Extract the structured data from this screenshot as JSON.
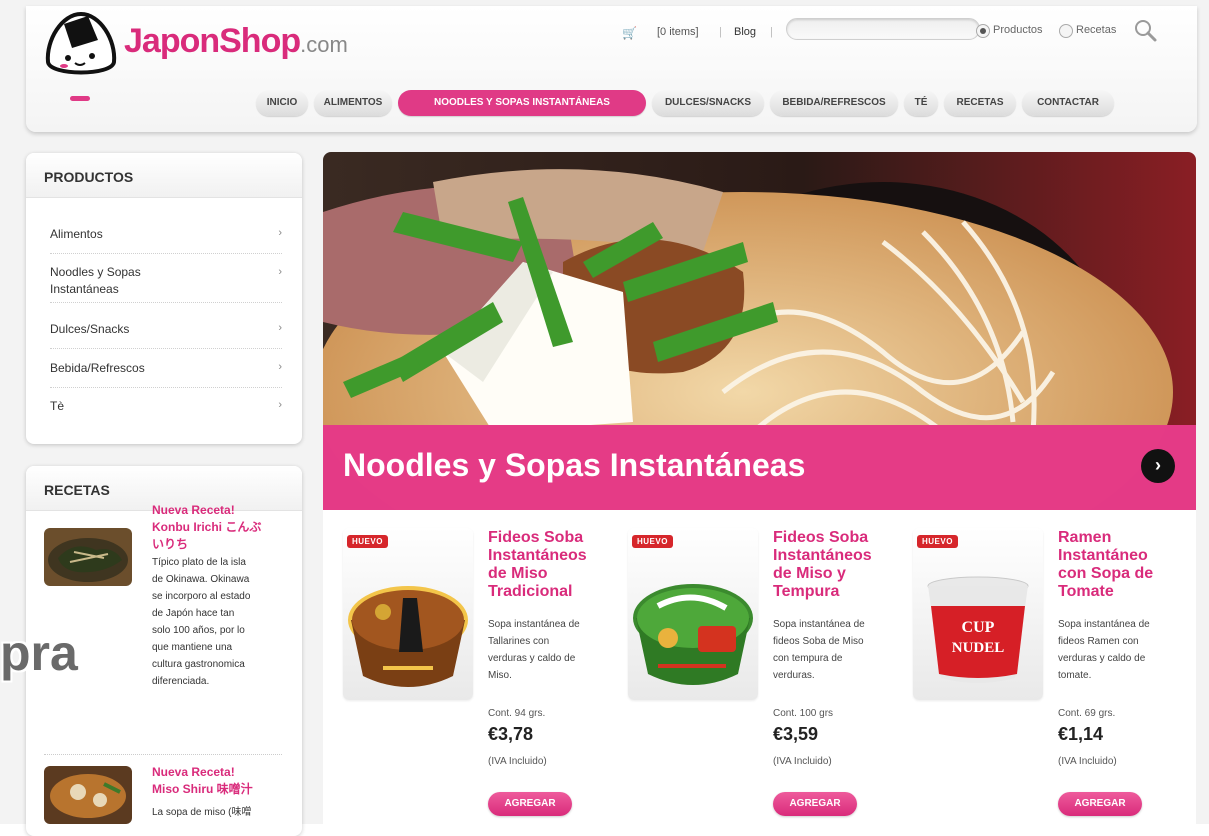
{
  "brand": {
    "name": "JaponShop",
    "suffix": ".com"
  },
  "topbar": {
    "cart_icon": "cart-icon",
    "cart_text": "[0 items]",
    "blog": "Blog",
    "search_value": "",
    "radio_products": "Productos",
    "radio_recipes": "Recetas",
    "selected": "Productos"
  },
  "nav": [
    "INICIO",
    "ALIMENTOS",
    "NOODLES Y SOPAS INSTANTÁNEAS",
    "DULCES/SNACKS",
    "BEBIDA/REFRESCOS",
    "TÉ",
    "RECETAS",
    "CONTACTAR"
  ],
  "nav_active": "NOODLES Y SOPAS INSTANTÁNEAS",
  "sidebar": {
    "products_title": "PRODUCTOS",
    "categories": [
      {
        "line1": "Alimentos",
        "line2": ""
      },
      {
        "line1": "Noodles y Sopas",
        "line2": "Instantáneas"
      },
      {
        "line1": "Dulces/Snacks",
        "line2": ""
      },
      {
        "line1": "Bebida/Refrescos",
        "line2": ""
      },
      {
        "line1": "Tè",
        "line2": ""
      }
    ],
    "arrow": "›",
    "recipes_title": "RECETAS",
    "recipes": [
      {
        "title": [
          "Nueva Receta!",
          "Konbu Irichi こんぶ",
          "いりち"
        ],
        "desc": [
          "Típico plato de la isla",
          "de Okinawa. Okinawa",
          "se incorporo al estado",
          "de Japón hace tan",
          "solo 100 años, por lo",
          "que mantiene una",
          "cultura gastronomica",
          "diferenciada."
        ]
      },
      {
        "title": [
          "Nueva Receta!",
          "Miso Shiru 味噌汁"
        ],
        "desc": [
          "La sopa de miso (味噌"
        ]
      }
    ]
  },
  "watermark": "pra",
  "banner": {
    "title": "Noodles y Sopas Instantáneas",
    "next": "›"
  },
  "products": [
    {
      "badge": "HUEVO",
      "title": [
        "Fideos Soba",
        "Instantáneos",
        "de Miso",
        "Tradicional"
      ],
      "desc": [
        "Sopa instantánea de",
        "Tallarines con",
        "verduras y caldo de",
        "Miso."
      ],
      "content": "Cont. 94 grs.",
      "price": "€3,78",
      "vat": "(IVA Incluido)",
      "button": "AGREGAR"
    },
    {
      "badge": "HUEVO",
      "title": [
        "Fideos Soba",
        "Instantáneos",
        "de Miso y",
        "Tempura"
      ],
      "desc": [
        "Sopa instantánea de",
        "fideos Soba de Miso",
        "con tempura de",
        "verduras."
      ],
      "content": "Cont. 100 grs",
      "price": "€3,59",
      "vat": "(IVA Incluido)",
      "button": "AGREGAR"
    },
    {
      "badge": "HUEVO",
      "title": [
        "Ramen",
        "Instantáneo",
        "con Sopa de",
        "Tomate"
      ],
      "desc": [
        "Sopa instantánea de",
        "fideos Ramen con",
        "verduras y caldo de",
        "tomate."
      ],
      "content": "Cont. 69 grs.",
      "price": "€1,14",
      "vat": "(IVA Incluido)",
      "button": "AGREGAR",
      "label_art": [
        "CUP",
        "NUDEL"
      ]
    }
  ],
  "colors": {
    "accent": "#e03a86",
    "brand": "#d92b7b",
    "badge": "#d6262b"
  }
}
